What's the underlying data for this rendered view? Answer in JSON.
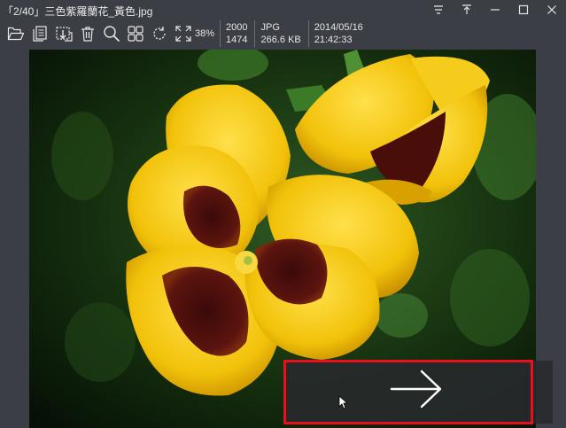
{
  "window": {
    "title": "「2/40」三色紫羅蘭花_黃色.jpg"
  },
  "toolbar": {
    "zoom": "38%",
    "info": {
      "width": "2000",
      "height": "1474",
      "format": "JPG",
      "filesize": "266.6 KB",
      "date": "2014/05/16",
      "time": "21:42:33"
    }
  },
  "icons": {
    "open": "folder-open-icon",
    "copy": "copy-icon",
    "move": "move-icon",
    "delete": "trash-icon",
    "search": "search-icon",
    "grid": "grid-icon",
    "rotate": "rotate-icon",
    "fullscreen": "fullscreen-icon",
    "next": "arrow-right-icon"
  },
  "colors": {
    "background": "#3b3e44",
    "highlight": "#e8101a",
    "petal": "#f2c20a"
  }
}
